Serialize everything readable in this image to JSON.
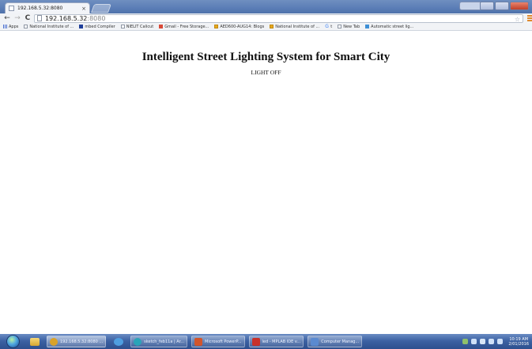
{
  "browser": {
    "tab": {
      "title": "192.168.5.32:8080",
      "close_glyph": "×"
    },
    "omnibox": {
      "host": "192.168.5.32",
      "port": ":8080"
    },
    "icons": {
      "back": "←",
      "forward": "→",
      "reload": "C",
      "star": "☆"
    }
  },
  "bookmarks": [
    {
      "label": "Apps",
      "icon": "apps-icon"
    },
    {
      "label": "National Institute of ...",
      "icon": "page-icon"
    },
    {
      "label": "mbed Compiler",
      "icon": "mbed-icon"
    },
    {
      "label": "NIELIT Calicut",
      "icon": "page-icon"
    },
    {
      "label": "Gmail - Free Storage...",
      "icon": "gmail-icon"
    },
    {
      "label": "AED600-AUG14: Blogs",
      "icon": "folder-icon"
    },
    {
      "label": "National Institute of ...",
      "icon": "folder-icon"
    },
    {
      "label": "t",
      "icon": "google-icon"
    },
    {
      "label": "New Tab",
      "icon": "page-icon"
    },
    {
      "label": "Automatic street lig...",
      "icon": "arduino-icon"
    }
  ],
  "page": {
    "title": "Intelligent Street Lighting System for Smart City",
    "status": "LIGHT OFF"
  },
  "taskbar": {
    "items": [
      {
        "label": "192.168.5.32:8080 ...",
        "icon": "chrome-icon",
        "color": "#d9a22a",
        "active": true
      },
      {
        "label": "sketch_feb11a | Ar...",
        "icon": "arduino-icon",
        "color": "#2aa4b8",
        "active": false
      },
      {
        "label": "Microsoft PowerP...",
        "icon": "powerpoint-icon",
        "color": "#d2552c",
        "active": false
      },
      {
        "label": "led - MPLAB IDE v...",
        "icon": "mplab-icon",
        "color": "#c8312a",
        "active": false
      },
      {
        "label": "Computer Manag...",
        "icon": "computer-management-icon",
        "color": "#5b8ad0",
        "active": false
      }
    ],
    "clock": {
      "time": "10:19 AM",
      "date": "2/01/2016"
    }
  }
}
